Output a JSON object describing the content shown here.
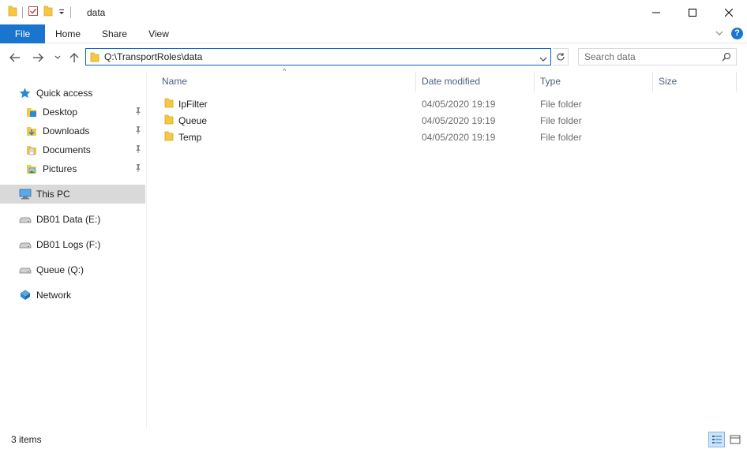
{
  "window": {
    "title": "data"
  },
  "ribbon": {
    "tabs": [
      {
        "label": "File"
      },
      {
        "label": "Home"
      },
      {
        "label": "Share"
      },
      {
        "label": "View"
      }
    ],
    "help_label": "?"
  },
  "address_bar": {
    "path": "Q:\\TransportRoles\\data"
  },
  "search": {
    "placeholder": "Search data"
  },
  "nav_pane": {
    "quick_access": "Quick access",
    "quick_items": [
      {
        "label": "Desktop"
      },
      {
        "label": "Downloads"
      },
      {
        "label": "Documents"
      },
      {
        "label": "Pictures"
      }
    ],
    "this_pc": "This PC",
    "drives": [
      {
        "label": "DB01 Data (E:)"
      },
      {
        "label": "DB01 Logs (F:)"
      },
      {
        "label": "Queue (Q:)"
      }
    ],
    "network": "Network"
  },
  "file_list": {
    "columns": {
      "name": "Name",
      "date_modified": "Date modified",
      "type": "Type",
      "size": "Size"
    },
    "sort_arrow": "^",
    "rows": [
      {
        "name": "IpFilter",
        "date_modified": "04/05/2020 19:19",
        "type": "File folder"
      },
      {
        "name": "Queue",
        "date_modified": "04/05/2020 19:19",
        "type": "File folder"
      },
      {
        "name": "Temp",
        "date_modified": "04/05/2020 19:19",
        "type": "File folder"
      }
    ]
  },
  "status_bar": {
    "item_count": "3 items"
  },
  "colors": {
    "accent": "#1a75cf",
    "folder": "#f5c842",
    "selected_bg": "#d9d9d9"
  }
}
